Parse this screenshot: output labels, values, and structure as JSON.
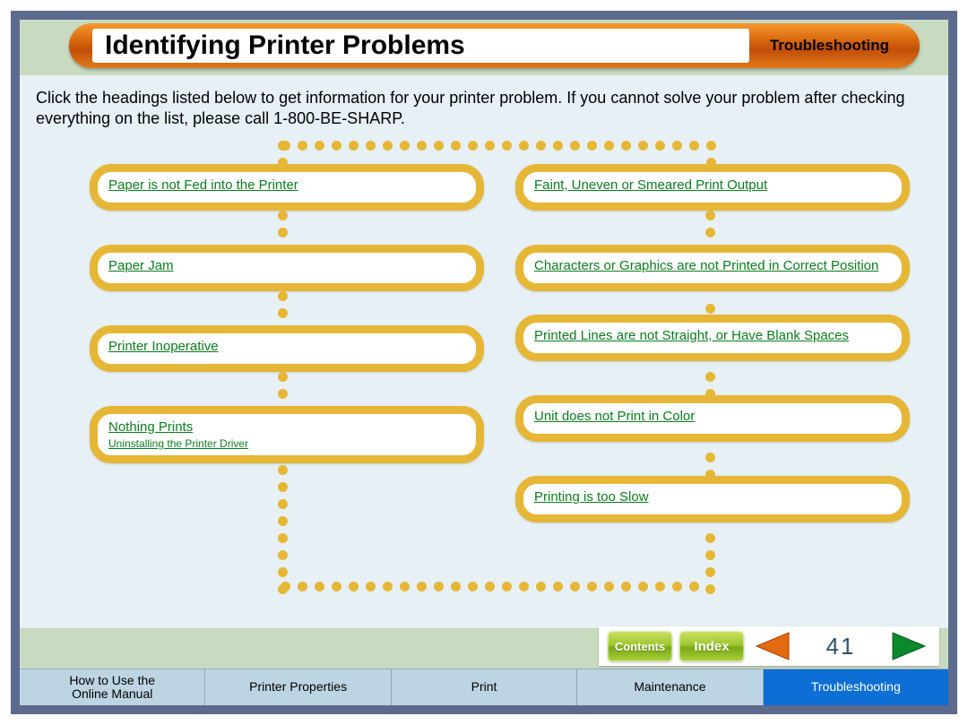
{
  "title": "Identifying Printer Problems",
  "section": "Troubleshooting",
  "intro": "Click the headings listed below to get information for your printer problem. If you cannot solve your problem after checking everything on the list, please call 1-800-BE-SHARP.",
  "topics": {
    "left": [
      {
        "label": "Paper is not Fed into the Printer",
        "sub": ""
      },
      {
        "label": "Paper Jam",
        "sub": ""
      },
      {
        "label": "Printer Inoperative",
        "sub": ""
      },
      {
        "label": "Nothing Prints",
        "sub": "Uninstalling the Printer Driver"
      }
    ],
    "right": [
      {
        "label": "Faint, Uneven or Smeared Print Output",
        "sub": ""
      },
      {
        "label": "Characters or Graphics are not Printed in Correct Position",
        "sub": ""
      },
      {
        "label": "Printed Lines are not Straight, or Have Blank Spaces",
        "sub": ""
      },
      {
        "label": "Unit does not Print in Color",
        "sub": ""
      },
      {
        "label": "Printing is too Slow",
        "sub": ""
      }
    ]
  },
  "nav": {
    "contents": "Contents",
    "index": "Index",
    "page": "41"
  },
  "tabs": [
    "How to Use the\nOnline Manual",
    "Printer Properties",
    "Print",
    "Maintenance",
    "Troubleshooting"
  ],
  "active_tab": 4
}
